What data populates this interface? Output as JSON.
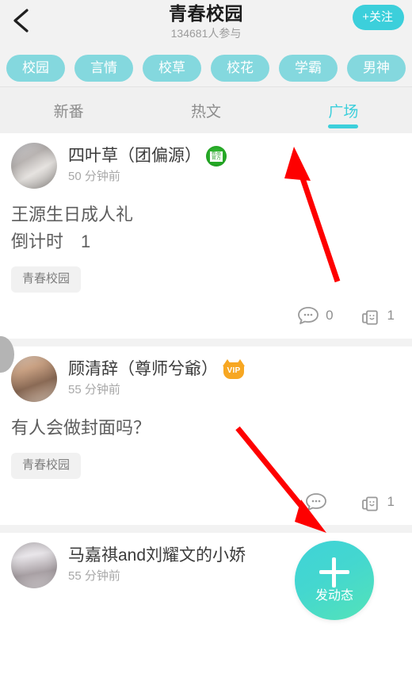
{
  "header": {
    "back_icon": "chevron-left-icon",
    "title": "青春校园",
    "participants": "134681人参与",
    "follow_label": "+关注",
    "accent_color": "#3ccfdb",
    "background_color": "#f2f2f2"
  },
  "chips": [
    {
      "label": "校园"
    },
    {
      "label": "言情"
    },
    {
      "label": "校草"
    },
    {
      "label": "校花"
    },
    {
      "label": "学霸"
    },
    {
      "label": "男神"
    }
  ],
  "chip_color": "#84d8de",
  "tabs": [
    {
      "label": "新番",
      "active": false
    },
    {
      "label": "热文",
      "active": false
    },
    {
      "label": "广场",
      "active": true
    }
  ],
  "posts": [
    {
      "name": "四叶草（团偏源）",
      "badge": "green-seal-badge",
      "badge_text": "新出官方",
      "time": "50 分钟前",
      "content": "王源生日成人礼\n倒计时　1",
      "tag": "青春校园",
      "comment_count": "0",
      "like_count": "1"
    },
    {
      "name": "顾清辞（尊师兮爺）",
      "badge": "vip-cat-badge",
      "badge_text": "VIP",
      "time": "55 分钟前",
      "content": "有人会做封面吗？",
      "tag": "青春校园",
      "comment_count": "",
      "like_count": "1"
    },
    {
      "name": "马嘉祺and刘耀文的小娇",
      "badge": "",
      "badge_text": "",
      "time": "55 分钟前",
      "content": "",
      "tag": "",
      "comment_count": "",
      "like_count": ""
    }
  ],
  "fab": {
    "icon": "plus-icon",
    "label": "发动态",
    "color": "#44d7cf"
  },
  "annotations": {
    "arrow_color": "#fe0000",
    "arrow_1_target": "广场 tab",
    "arrow_2_target": "发动态 floating button"
  }
}
